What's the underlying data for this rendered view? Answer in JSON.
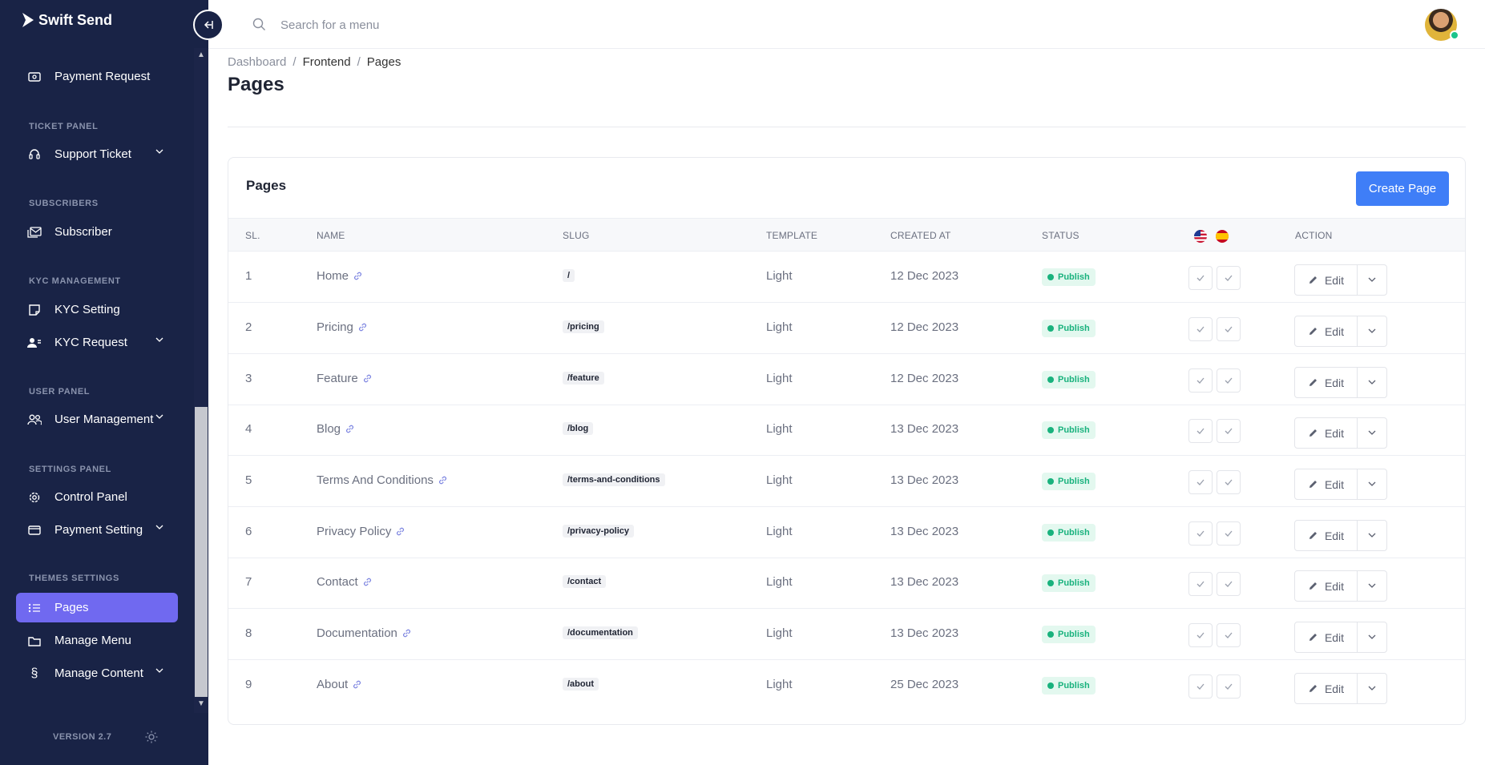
{
  "app": {
    "logo_text": "Swift Send",
    "version": "VERSION 2.7"
  },
  "sidebar": {
    "items": [
      {
        "label": "Payment Request",
        "icon": "money-icon",
        "section": null
      },
      {
        "section_label": "TICKET PANEL"
      },
      {
        "label": "Support Ticket",
        "icon": "headset-icon",
        "has_submenu": true
      },
      {
        "section_label": "SUBSCRIBERS"
      },
      {
        "label": "Subscriber",
        "icon": "mail-stack-icon"
      },
      {
        "section_label": "KYC MANAGEMENT"
      },
      {
        "label": "KYC Setting",
        "icon": "id-card-icon"
      },
      {
        "label": "KYC Request",
        "icon": "user-group-icon",
        "has_submenu": true
      },
      {
        "section_label": "USER PANEL"
      },
      {
        "label": "User Management",
        "icon": "users-icon",
        "has_submenu": true
      },
      {
        "section_label": "SETTINGS PANEL"
      },
      {
        "label": "Control Panel",
        "icon": "gear-icon"
      },
      {
        "label": "Payment Setting",
        "icon": "wallet-icon",
        "has_submenu": true
      },
      {
        "section_label": "THEMES SETTINGS"
      },
      {
        "label": "Pages",
        "icon": "list-icon",
        "active": true
      },
      {
        "label": "Manage Menu",
        "icon": "folder-icon"
      },
      {
        "label": "Manage Content",
        "icon": "section-icon",
        "has_submenu": true
      }
    ],
    "labels": {
      "payment_request": "Payment Request",
      "ticket_panel": "TICKET PANEL",
      "support_ticket": "Support Ticket",
      "subscribers": "SUBSCRIBERS",
      "subscriber": "Subscriber",
      "kyc_management": "KYC MANAGEMENT",
      "kyc_setting": "KYC Setting",
      "kyc_request": "KYC Request",
      "user_panel": "USER PANEL",
      "user_management": "User Management",
      "settings_panel": "SETTINGS PANEL",
      "control_panel": "Control Panel",
      "payment_setting": "Payment Setting",
      "themes_settings": "THEMES SETTINGS",
      "pages": "Pages",
      "manage_menu": "Manage Menu",
      "manage_content": "Manage Content",
      "section_glyph": "§"
    },
    "active_color": "#7069f0",
    "background_color": "#192346"
  },
  "header": {
    "search_placeholder": "Search for a menu"
  },
  "breadcrumb": {
    "items": [
      "Dashboard",
      "Frontend",
      "Pages"
    ],
    "separator": "/"
  },
  "page_title": "Pages",
  "card": {
    "title": "Pages",
    "create_button": "Create Page",
    "accent_color": "#3f7ef7",
    "columns": [
      "SL.",
      "NAME",
      "SLUG",
      "TEMPLATE",
      "CREATED AT",
      "STATUS",
      "ACTION"
    ],
    "language_flags": [
      "us-flag-icon",
      "es-flag-icon"
    ],
    "edit_label": "Edit",
    "rows": [
      {
        "sl": "1",
        "name": "Home",
        "slug": "/",
        "template": "Light",
        "created_at": "12 Dec 2023",
        "status": "Publish"
      },
      {
        "sl": "2",
        "name": "Pricing",
        "slug": "/pricing",
        "template": "Light",
        "created_at": "12 Dec 2023",
        "status": "Publish"
      },
      {
        "sl": "3",
        "name": "Feature",
        "slug": "/feature",
        "template": "Light",
        "created_at": "12 Dec 2023",
        "status": "Publish"
      },
      {
        "sl": "4",
        "name": "Blog",
        "slug": "/blog",
        "template": "Light",
        "created_at": "13 Dec 2023",
        "status": "Publish"
      },
      {
        "sl": "5",
        "name": "Terms And Conditions",
        "slug": "/terms-and-conditions",
        "template": "Light",
        "created_at": "13 Dec 2023",
        "status": "Publish"
      },
      {
        "sl": "6",
        "name": "Privacy Policy",
        "slug": "/privacy-policy",
        "template": "Light",
        "created_at": "13 Dec 2023",
        "status": "Publish"
      },
      {
        "sl": "7",
        "name": "Contact",
        "slug": "/contact",
        "template": "Light",
        "created_at": "13 Dec 2023",
        "status": "Publish"
      },
      {
        "sl": "8",
        "name": "Documentation",
        "slug": "/documentation",
        "template": "Light",
        "created_at": "13 Dec 2023",
        "status": "Publish"
      },
      {
        "sl": "9",
        "name": "About",
        "slug": "/about",
        "template": "Light",
        "created_at": "25 Dec 2023",
        "status": "Publish"
      }
    ],
    "status_color": "#19b27d"
  }
}
